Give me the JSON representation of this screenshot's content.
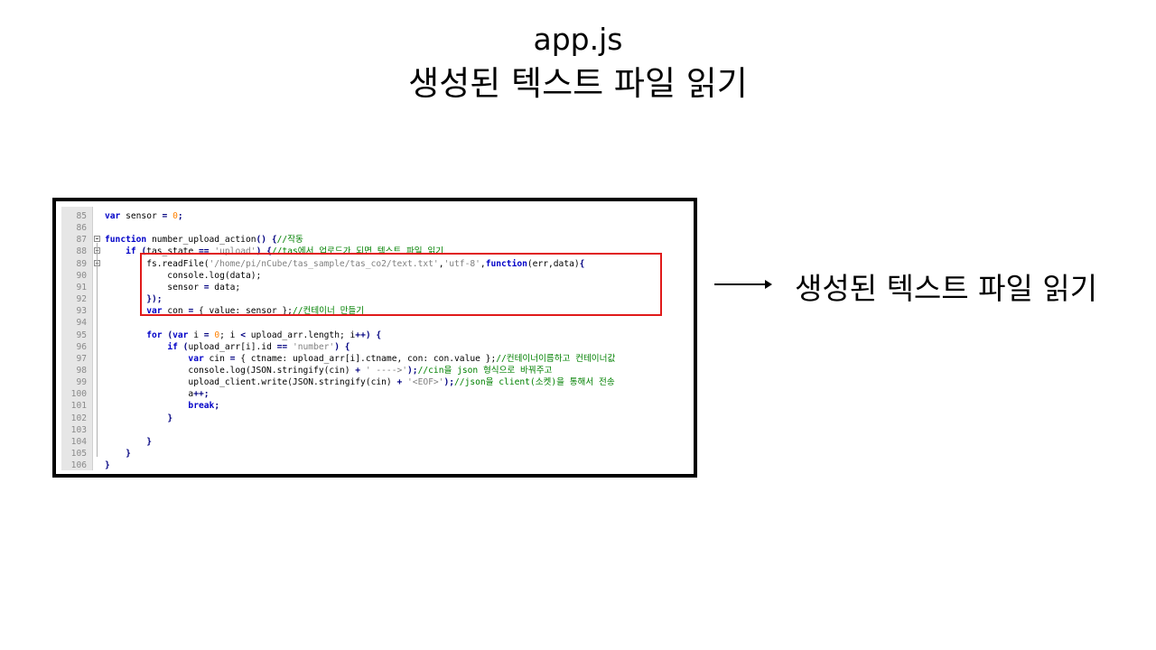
{
  "slide": {
    "title_line1": "app.js",
    "title_line2": "생성된 텍스트 파일 읽기",
    "annotation_label": "생성된 텍스트 파일 읽기"
  },
  "code": {
    "lines": [
      {
        "num": "85",
        "tokens": [
          {
            "t": "k",
            "v": "var"
          },
          {
            "t": "p",
            "v": " sensor "
          },
          {
            "t": "o",
            "v": "="
          },
          {
            "t": "p",
            "v": " "
          },
          {
            "t": "n",
            "v": "0"
          },
          {
            "t": "o",
            "v": ";"
          }
        ]
      },
      {
        "num": "86",
        "tokens": []
      },
      {
        "num": "87",
        "tokens": [
          {
            "t": "k",
            "v": "function"
          },
          {
            "t": "p",
            "v": " number_upload_action"
          },
          {
            "t": "o",
            "v": "()"
          },
          {
            "t": "p",
            "v": " "
          },
          {
            "t": "o",
            "v": "{"
          },
          {
            "t": "c",
            "v": "//작동"
          }
        ]
      },
      {
        "num": "88",
        "tokens": [
          {
            "t": "p",
            "v": "    "
          },
          {
            "t": "k",
            "v": "if"
          },
          {
            "t": "p",
            "v": " "
          },
          {
            "t": "o",
            "v": "("
          },
          {
            "t": "p",
            "v": "tas_state "
          },
          {
            "t": "o",
            "v": "=="
          },
          {
            "t": "p",
            "v": " "
          },
          {
            "t": "s",
            "v": "'upload'"
          },
          {
            "t": "o",
            "v": ")"
          },
          {
            "t": "p",
            "v": " "
          },
          {
            "t": "o",
            "v": "{"
          },
          {
            "t": "c",
            "v": "//tas에서 업로드가 되면 텍스트 파일 읽기"
          }
        ]
      },
      {
        "num": "89",
        "tokens": [
          {
            "t": "p",
            "v": "        fs.readFile("
          },
          {
            "t": "s",
            "v": "'/home/pi/nCube/tas_sample/tas_co2/text.txt'"
          },
          {
            "t": "p",
            "v": ","
          },
          {
            "t": "s",
            "v": "'utf-8'"
          },
          {
            "t": "p",
            "v": ","
          },
          {
            "t": "k",
            "v": "function"
          },
          {
            "t": "p",
            "v": "(err,data)"
          },
          {
            "t": "o",
            "v": "{"
          }
        ]
      },
      {
        "num": "90",
        "tokens": [
          {
            "t": "p",
            "v": "            console.log(data);"
          }
        ]
      },
      {
        "num": "91",
        "tokens": [
          {
            "t": "p",
            "v": "            sensor "
          },
          {
            "t": "o",
            "v": "="
          },
          {
            "t": "p",
            "v": " data;"
          }
        ]
      },
      {
        "num": "92",
        "tokens": [
          {
            "t": "p",
            "v": "        "
          },
          {
            "t": "o",
            "v": "});"
          }
        ]
      },
      {
        "num": "93",
        "tokens": [
          {
            "t": "p",
            "v": "        "
          },
          {
            "t": "k",
            "v": "var"
          },
          {
            "t": "p",
            "v": " con "
          },
          {
            "t": "o",
            "v": "="
          },
          {
            "t": "p",
            "v": " { value: sensor };"
          },
          {
            "t": "c",
            "v": "//컨테이너 만들기"
          }
        ]
      },
      {
        "num": "94",
        "tokens": []
      },
      {
        "num": "95",
        "tokens": [
          {
            "t": "p",
            "v": "        "
          },
          {
            "t": "k",
            "v": "for"
          },
          {
            "t": "p",
            "v": " "
          },
          {
            "t": "o",
            "v": "("
          },
          {
            "t": "k",
            "v": "var"
          },
          {
            "t": "p",
            "v": " i "
          },
          {
            "t": "o",
            "v": "="
          },
          {
            "t": "p",
            "v": " "
          },
          {
            "t": "n",
            "v": "0"
          },
          {
            "t": "p",
            "v": "; i "
          },
          {
            "t": "o",
            "v": "<"
          },
          {
            "t": "p",
            "v": " upload_arr.length; i"
          },
          {
            "t": "o",
            "v": "++)"
          },
          {
            "t": "p",
            "v": " "
          },
          {
            "t": "o",
            "v": "{"
          }
        ]
      },
      {
        "num": "96",
        "tokens": [
          {
            "t": "p",
            "v": "            "
          },
          {
            "t": "k",
            "v": "if"
          },
          {
            "t": "p",
            "v": " "
          },
          {
            "t": "o",
            "v": "("
          },
          {
            "t": "p",
            "v": "upload_arr[i].id "
          },
          {
            "t": "o",
            "v": "=="
          },
          {
            "t": "p",
            "v": " "
          },
          {
            "t": "s",
            "v": "'number'"
          },
          {
            "t": "o",
            "v": ")"
          },
          {
            "t": "p",
            "v": " "
          },
          {
            "t": "o",
            "v": "{"
          }
        ]
      },
      {
        "num": "97",
        "tokens": [
          {
            "t": "p",
            "v": "                "
          },
          {
            "t": "k",
            "v": "var"
          },
          {
            "t": "p",
            "v": " cin "
          },
          {
            "t": "o",
            "v": "="
          },
          {
            "t": "p",
            "v": " { ctname: upload_arr[i].ctname, con: con.value };"
          },
          {
            "t": "c",
            "v": "//컨테이너이름하고 컨테이너값"
          }
        ]
      },
      {
        "num": "98",
        "tokens": [
          {
            "t": "p",
            "v": "                console.log(JSON.stringify(cin) "
          },
          {
            "t": "o",
            "v": "+"
          },
          {
            "t": "p",
            "v": " "
          },
          {
            "t": "s",
            "v": "' ---->'"
          },
          {
            "t": "o",
            "v": ");"
          },
          {
            "t": "c",
            "v": "//cin을 json 형식으로 바꿔주고"
          }
        ]
      },
      {
        "num": "99",
        "tokens": [
          {
            "t": "p",
            "v": "                upload_client.write(JSON.stringify(cin) "
          },
          {
            "t": "o",
            "v": "+"
          },
          {
            "t": "p",
            "v": " "
          },
          {
            "t": "s",
            "v": "'<EOF>'"
          },
          {
            "t": "o",
            "v": ");"
          },
          {
            "t": "c",
            "v": "//json을 client(소켓)을 통해서 전송"
          }
        ]
      },
      {
        "num": "100",
        "tokens": [
          {
            "t": "p",
            "v": "                a"
          },
          {
            "t": "o",
            "v": "++;"
          }
        ]
      },
      {
        "num": "101",
        "tokens": [
          {
            "t": "p",
            "v": "                "
          },
          {
            "t": "k",
            "v": "break"
          },
          {
            "t": "o",
            "v": ";"
          }
        ]
      },
      {
        "num": "102",
        "tokens": [
          {
            "t": "p",
            "v": "            "
          },
          {
            "t": "o",
            "v": "}"
          }
        ]
      },
      {
        "num": "103",
        "tokens": []
      },
      {
        "num": "104",
        "tokens": [
          {
            "t": "p",
            "v": "        "
          },
          {
            "t": "o",
            "v": "}"
          }
        ]
      },
      {
        "num": "105",
        "tokens": [
          {
            "t": "p",
            "v": "    "
          },
          {
            "t": "o",
            "v": "}"
          }
        ]
      },
      {
        "num": "106",
        "tokens": [
          {
            "t": "o",
            "v": "}"
          }
        ]
      }
    ]
  }
}
